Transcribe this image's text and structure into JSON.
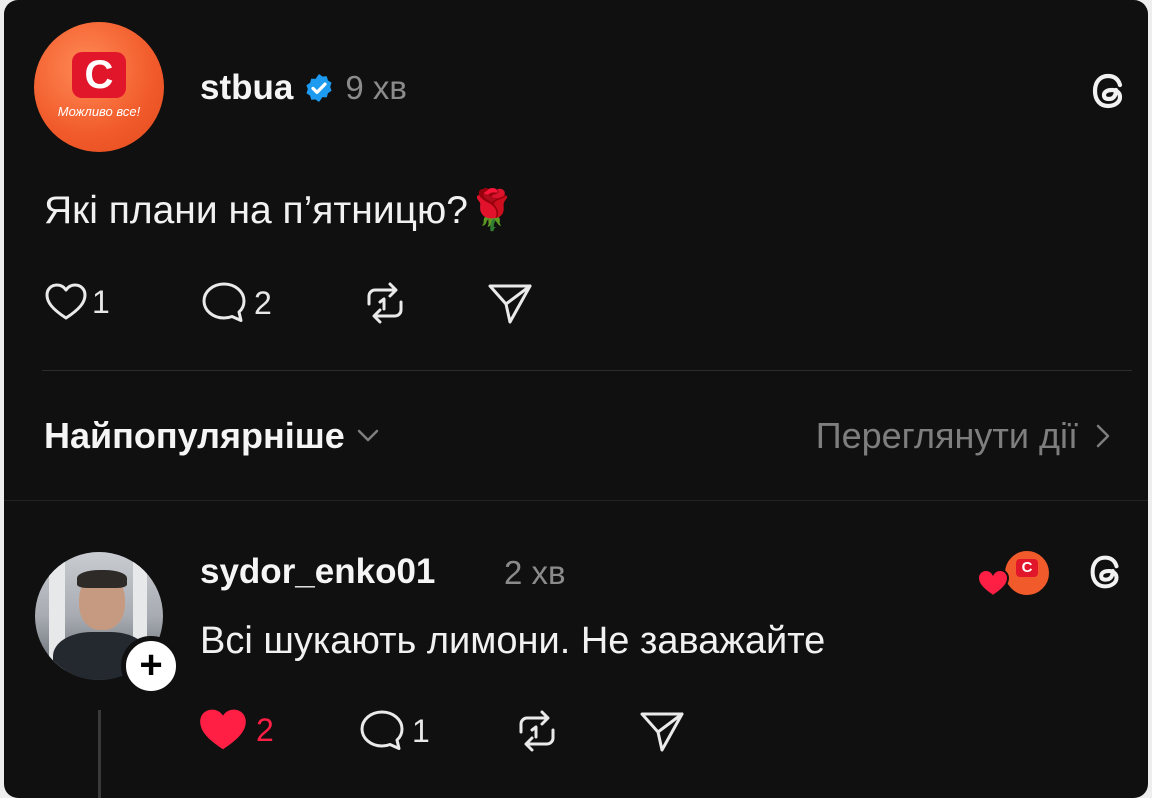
{
  "post": {
    "username": "stbua",
    "time": "9 хв",
    "text": "Які плани на п’ятницю?🌹",
    "avatar_letter": "С",
    "avatar_tagline": "Можливо все!",
    "likes": "1",
    "comments": "2"
  },
  "sort": {
    "label": "Найпопулярніше",
    "view_activity": "Переглянути дії"
  },
  "reply": {
    "username": "sydor_enko01",
    "time": "2 хв",
    "text": "Всі шукають лимони. Не заважайте",
    "likes": "2",
    "comments": "1"
  },
  "colors": {
    "background": "#101010",
    "verified": "#1d9bf0",
    "liked": "#ff1f44",
    "brand_red": "#e2162b",
    "brand_orange": "#f15a2a"
  },
  "icons": {
    "threads": "threads-icon",
    "heart": "heart-icon",
    "comment": "comment-icon",
    "repost": "repost-icon",
    "share": "share-icon"
  }
}
